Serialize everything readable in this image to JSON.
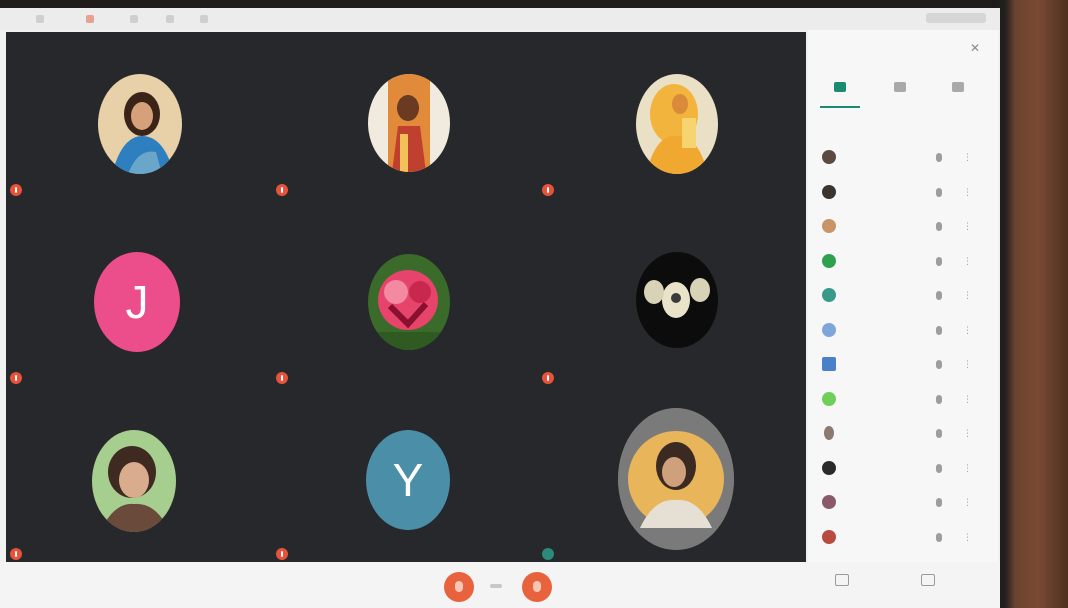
{
  "browser": {
    "tabs": [
      "",
      "",
      "",
      "",
      ""
    ]
  },
  "meeting": {
    "info": "",
    "tiles": [
      {
        "initial": "",
        "name": "",
        "mic": "off",
        "avatar_colors": [
          "#2d7fc0",
          "#e8d0a8",
          "#6aa6c9"
        ]
      },
      {
        "initial": "",
        "name": "",
        "mic": "off",
        "avatar_colors": [
          "#e08a3a",
          "#f0eadf",
          "#c04030"
        ]
      },
      {
        "initial": "",
        "name": "",
        "mic": "off",
        "avatar_colors": [
          "#f2b43c",
          "#e9e0c6",
          "#d98a3a"
        ]
      },
      {
        "initial": "J",
        "name": "",
        "mic": "off",
        "avatar_colors": [
          "#ec4d8b"
        ]
      },
      {
        "initial": "",
        "name": "",
        "mic": "off",
        "avatar_colors": [
          "#e6446a",
          "#3a6b2a",
          "#f38aa2"
        ]
      },
      {
        "initial": "",
        "name": "",
        "mic": "off",
        "avatar_colors": [
          "#0c0c0c",
          "#e8e3c9",
          "#3b3b3b"
        ]
      },
      {
        "initial": "",
        "name": "",
        "mic": "off",
        "avatar_colors": [
          "#3f2a22",
          "#a6cf8f",
          "#d8ac8c"
        ]
      },
      {
        "initial": "Y",
        "name": "",
        "mic": "off",
        "avatar_colors": [
          "#4a8ea8"
        ]
      },
      {
        "initial": "",
        "name": "",
        "mic": "on",
        "avatar_colors": [
          "#7a7a7a",
          "#e9b55a",
          "#3a2a22"
        ]
      }
    ]
  },
  "controls": {
    "present_label": "",
    "activities_label": ""
  },
  "panel": {
    "title": "",
    "participants": [
      {
        "name": "",
        "color": "#5a4a40"
      },
      {
        "name": "",
        "color": "#3a3530"
      },
      {
        "name": "",
        "color": "#c89468"
      },
      {
        "name": "",
        "color": "#2fa04e"
      },
      {
        "name": "",
        "color": "#3a9a8a"
      },
      {
        "name": "",
        "color": "#7fa6d8"
      },
      {
        "name": "",
        "color": "#4a80c8"
      },
      {
        "name": "",
        "color": "#6fcf5a"
      },
      {
        "name": "",
        "color": "#8a7a70"
      },
      {
        "name": "",
        "color": "#2a2a2a"
      },
      {
        "name": "",
        "color": "#8a5a6a"
      },
      {
        "name": "",
        "color": "#b84a40"
      }
    ]
  }
}
